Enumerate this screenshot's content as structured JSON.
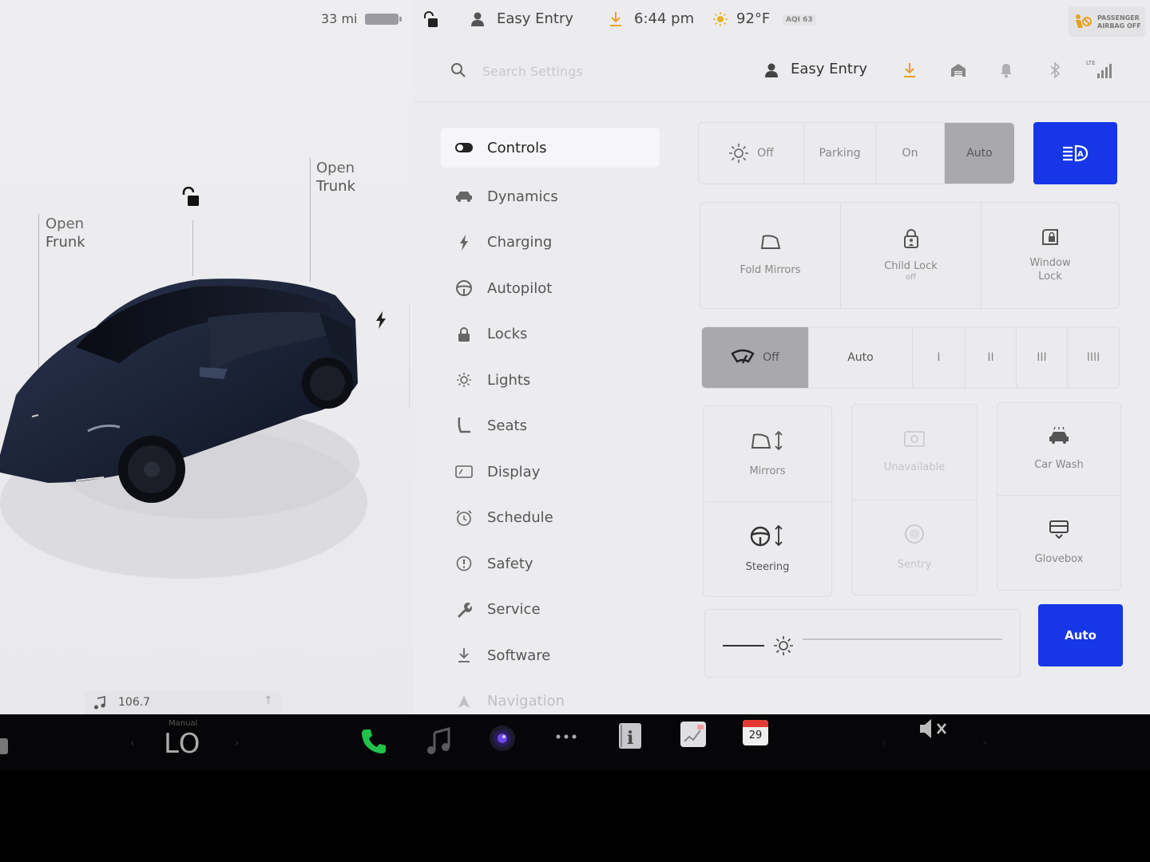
{
  "status_bar": {
    "range": "33 mi",
    "profile": "Easy Entry",
    "time": "6:44 pm",
    "temperature": "92°F",
    "aqi": "AQI 63",
    "airbag_line1": "PASSENGER",
    "airbag_line2": "AIRBAG OFF"
  },
  "car_view": {
    "frunk_line1": "Open",
    "frunk_line2": "Frunk",
    "trunk_line1": "Open",
    "trunk_line2": "Trunk"
  },
  "media": {
    "station": "106.7"
  },
  "settings_header": {
    "search_placeholder": "Search Settings",
    "profile": "Easy Entry"
  },
  "sidebar": {
    "items": [
      {
        "label": "Controls",
        "icon": "toggle-icon"
      },
      {
        "label": "Dynamics",
        "icon": "car-icon"
      },
      {
        "label": "Charging",
        "icon": "bolt-icon"
      },
      {
        "label": "Autopilot",
        "icon": "steering-wheel-icon"
      },
      {
        "label": "Locks",
        "icon": "lock-icon"
      },
      {
        "label": "Lights",
        "icon": "sun-icon"
      },
      {
        "label": "Seats",
        "icon": "seat-icon"
      },
      {
        "label": "Display",
        "icon": "display-icon"
      },
      {
        "label": "Schedule",
        "icon": "alarm-icon"
      },
      {
        "label": "Safety",
        "icon": "alert-circle-icon"
      },
      {
        "label": "Service",
        "icon": "wrench-icon"
      },
      {
        "label": "Software",
        "icon": "download-icon"
      },
      {
        "label": "Navigation",
        "icon": "navigation-icon"
      }
    ],
    "active_index": 0
  },
  "controls": {
    "headlights": {
      "options": [
        "Off",
        "Parking",
        "On",
        "Auto"
      ],
      "selected": "Auto"
    },
    "fold_mirrors": "Fold Mirrors",
    "child_lock": "Child Lock",
    "child_lock_state": "off",
    "window_lock_line1": "Window",
    "window_lock_line2": "Lock",
    "wipers": {
      "options": [
        "Off",
        "Auto",
        "I",
        "II",
        "III",
        "IIII"
      ],
      "selected": "Off"
    },
    "mirrors": "Mirrors",
    "unavailable": "Unavailable",
    "car_wash": "Car Wash",
    "steering": "Steering",
    "sentry": "Sentry",
    "glovebox": "Glovebox",
    "brightness_auto": "Auto",
    "brightness_level": 0.0
  },
  "dock": {
    "climate_mode": "Manual",
    "climate_temp": "LO",
    "calendar_day": "29"
  },
  "colors": {
    "accent_blue": "#1636e8",
    "phone_green": "#22c24a",
    "download_orange": "#e8a020"
  }
}
